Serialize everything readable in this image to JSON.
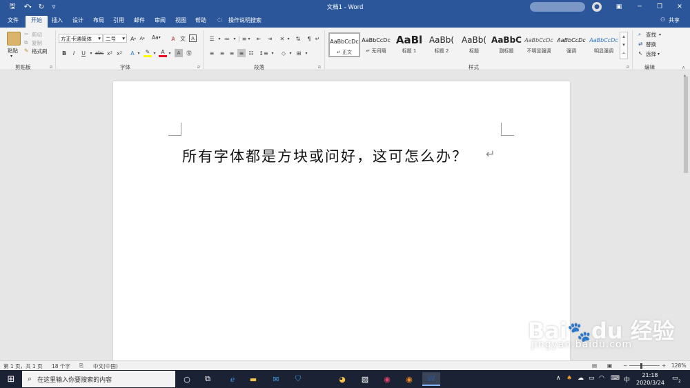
{
  "titlebar": {
    "title": "文档1 - Word",
    "quick_access": {
      "save": "🖫",
      "undo": "↶",
      "redo": "↻",
      "customize": "▿"
    }
  },
  "tabs": [
    {
      "label": "文件"
    },
    {
      "label": "开始"
    },
    {
      "label": "插入"
    },
    {
      "label": "设计"
    },
    {
      "label": "布局"
    },
    {
      "label": "引用"
    },
    {
      "label": "邮件"
    },
    {
      "label": "审阅"
    },
    {
      "label": "视图"
    },
    {
      "label": "帮助"
    }
  ],
  "tell_me": "操作说明搜索",
  "share": "共享",
  "clipboard": {
    "paste": "粘贴",
    "cut": "剪切",
    "copy": "复制",
    "format_painter": "格式刷",
    "group": "剪贴板"
  },
  "font": {
    "name": "方正卡通简体",
    "size": "二号",
    "group": "字体",
    "case": "Aa"
  },
  "paragraph": {
    "group": "段落"
  },
  "styles": {
    "group": "样式",
    "items": [
      {
        "preview": "AaBbCcDc",
        "name": "↵ 正文"
      },
      {
        "preview": "AaBbCcDc",
        "name": "↵ 无间隔"
      },
      {
        "preview": "AaBl",
        "name": "标题 1"
      },
      {
        "preview": "AaBb(",
        "name": "标题 2"
      },
      {
        "preview": "AaBb(",
        "name": "标题"
      },
      {
        "preview": "AaBbC",
        "name": "副标题"
      },
      {
        "preview": "AaBbCcDc",
        "name": "不明显强调"
      },
      {
        "preview": "AaBbCcDc",
        "name": "强调"
      },
      {
        "preview": "AaBbCcDc",
        "name": "明显强调"
      }
    ]
  },
  "editing": {
    "find": "查找",
    "replace": "替换",
    "select": "选择",
    "group": "编辑"
  },
  "document": {
    "text": "所有字体都是方块或问好，这可怎么办？",
    "para_mark": "↵"
  },
  "status": {
    "page": "第 1 页，共 1 页",
    "words": "18 个字",
    "language": "中文(中国)",
    "zoom": "128%"
  },
  "taskbar": {
    "search_placeholder": "在这里输入你要搜索的内容",
    "ime": "中",
    "time": "21:18",
    "date": "2020/3/24",
    "notifications": "2"
  },
  "watermark": {
    "text": "Bai du 经验",
    "url": "jingyan.baidu.com"
  },
  "colors": {
    "accent": "#2b579a",
    "taskbar": "#1b2233",
    "highlight": "#ffff00",
    "font_color": "#e81123"
  }
}
